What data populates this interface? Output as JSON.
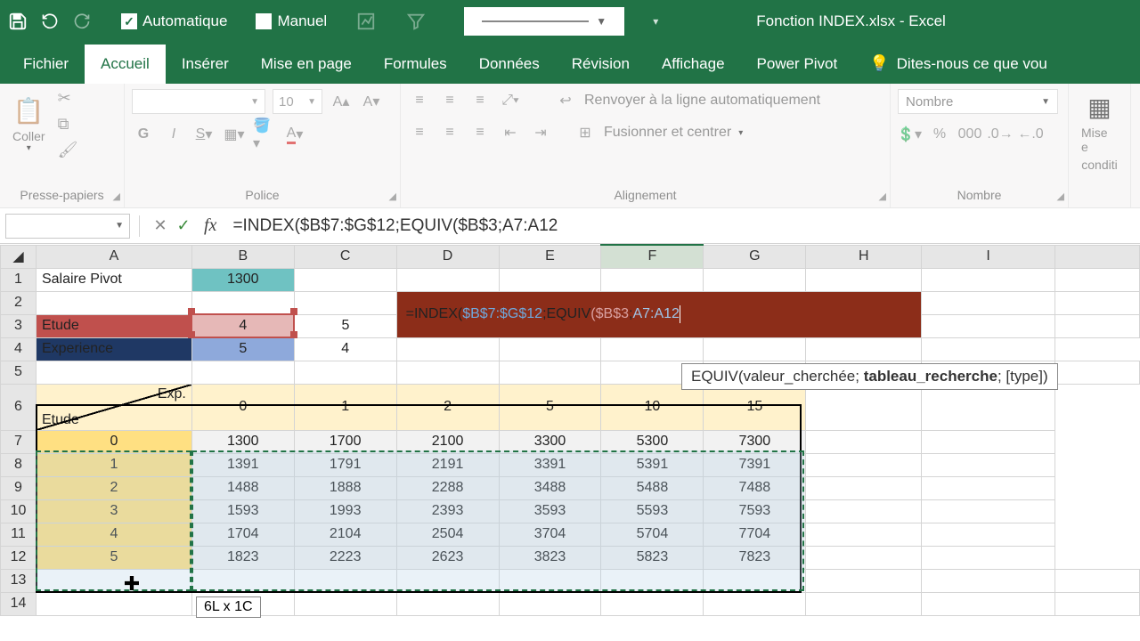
{
  "app": {
    "title": "Fonction INDEX.xlsx - Excel"
  },
  "qat": {
    "auto": "Automatique",
    "manual": "Manuel",
    "auto_checked": "✓"
  },
  "tabs": {
    "file": "Fichier",
    "home": "Accueil",
    "insert": "Insérer",
    "layout": "Mise en page",
    "formulas": "Formules",
    "data": "Données",
    "review": "Révision",
    "view": "Affichage",
    "powerpivot": "Power Pivot",
    "tellme": "Dites-nous ce que vou"
  },
  "ribbon": {
    "clipboard": {
      "label": "Presse-papiers",
      "paste": "Coller"
    },
    "font": {
      "label": "Police",
      "size": "10"
    },
    "alignment": {
      "label": "Alignement",
      "wrap": "Renvoyer à la ligne automatiquement",
      "merge": "Fusionner et centrer"
    },
    "number": {
      "label": "Nombre",
      "format": "Nombre"
    },
    "styles": {
      "cond": "Mise e",
      "cond2": "conditi"
    }
  },
  "fbar": {
    "formula": "=INDEX($B$7:$G$12;EQUIV($B$3;A7:A12"
  },
  "sheet": {
    "a1": "Salaire Pivot",
    "b1": "1300",
    "a3": "Etude",
    "b3": "4",
    "c3": "5",
    "a4": "Experience",
    "b4": "5",
    "c4": "4",
    "diag_tl": "Exp.",
    "diag_bl": "Etude",
    "colhdrs": [
      "0",
      "1",
      "2",
      "5",
      "10",
      "15"
    ],
    "rowlbls": [
      "0",
      "1",
      "2",
      "3",
      "4",
      "5"
    ],
    "data": [
      [
        "1300",
        "1700",
        "2100",
        "3300",
        "5300",
        "7300"
      ],
      [
        "1391",
        "1791",
        "2191",
        "3391",
        "5391",
        "7391"
      ],
      [
        "1488",
        "1888",
        "2288",
        "3488",
        "5488",
        "7488"
      ],
      [
        "1593",
        "1993",
        "2393",
        "3593",
        "5593",
        "7593"
      ],
      [
        "1704",
        "2104",
        "2504",
        "3704",
        "5704",
        "7704"
      ],
      [
        "1823",
        "2223",
        "2623",
        "3823",
        "5823",
        "7823"
      ]
    ],
    "inline_formula_prefix": "=INDEX(",
    "inline_ref1": "$B$7:$G$12",
    "inline_sep1": ";EQUIV",
    "inline_ref2": "($B$3",
    "inline_sep2": ";",
    "inline_ref3": "A7:A12",
    "tooltip": "EQUIV(valeur_cherchée; ",
    "tooltip_bold": "tableau_recherche",
    "tooltip_end": "; [type])",
    "seltip": "6L x 1C"
  },
  "cols": [
    "A",
    "B",
    "C",
    "D",
    "E",
    "F",
    "G",
    "H",
    "I"
  ],
  "chart_data": {
    "type": "table",
    "title": "Salaire Pivot",
    "xlabel": "Exp.",
    "ylabel": "Etude",
    "x": [
      0,
      1,
      2,
      5,
      10,
      15
    ],
    "y": [
      0,
      1,
      2,
      3,
      4,
      5
    ],
    "values": [
      [
        1300,
        1700,
        2100,
        3300,
        5300,
        7300
      ],
      [
        1391,
        1791,
        2191,
        3391,
        5391,
        7391
      ],
      [
        1488,
        1888,
        2288,
        3488,
        5488,
        7488
      ],
      [
        1593,
        1993,
        2393,
        3593,
        5593,
        7593
      ],
      [
        1704,
        2104,
        2504,
        3704,
        5704,
        7704
      ],
      [
        1823,
        2223,
        2623,
        3823,
        5823,
        7823
      ]
    ]
  }
}
